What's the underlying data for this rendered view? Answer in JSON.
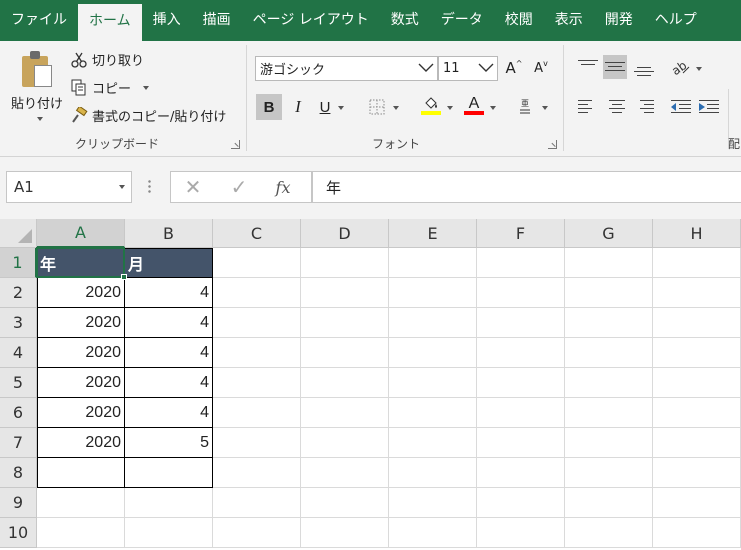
{
  "ribbon_tabs": [
    "ファイル",
    "ホーム",
    "挿入",
    "描画",
    "ページ レイアウト",
    "数式",
    "データ",
    "校閲",
    "表示",
    "開発",
    "ヘルプ"
  ],
  "active_tab": "ホーム",
  "clipboard": {
    "paste_label": "貼り付け",
    "cut_label": "切り取り",
    "copy_label": "コピー",
    "format_painter_label": "書式のコピー/貼り付け",
    "group_label": "クリップボード"
  },
  "font": {
    "font_name": "游ゴシック",
    "font_size": "11",
    "grow_label": "A",
    "shrink_label": "A",
    "bold_label": "B",
    "italic_label": "I",
    "underline_label": "U",
    "font_color_label": "A",
    "group_label": "フォント",
    "fill_color": "#ffff00",
    "font_color": "#ff0000"
  },
  "alignment": {
    "group_label_partial": "配"
  },
  "formula_bar": {
    "name_box": "A1",
    "cancel_symbol": "✕",
    "enter_symbol": "✓",
    "fx_label": "fx",
    "formula": "年"
  },
  "sheet": {
    "columns": [
      "A",
      "B",
      "C",
      "D",
      "E",
      "F",
      "G",
      "H"
    ],
    "rows": [
      "1",
      "2",
      "3",
      "4",
      "5",
      "6",
      "7",
      "8",
      "9",
      "10"
    ],
    "active_cell": "A1",
    "header_row": [
      "年",
      "月"
    ],
    "data": [
      [
        "2020",
        "4"
      ],
      [
        "2020",
        "4"
      ],
      [
        "2020",
        "4"
      ],
      [
        "2020",
        "4"
      ],
      [
        "2020",
        "4"
      ],
      [
        "2020",
        "5"
      ]
    ],
    "header_fill": "#44546a",
    "accent": "#217346"
  }
}
